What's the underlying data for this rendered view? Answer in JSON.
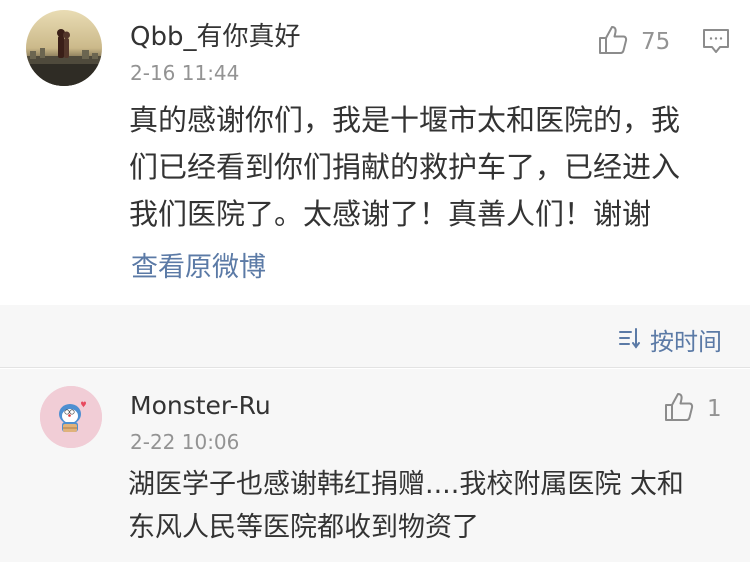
{
  "top_comment": {
    "username": "Qbb_有你真好",
    "time": "2-16 11:44",
    "text_lines": [
      "真的感谢你们，我是十堰市太和医院的，我",
      "们已经看到你们捐献的救护车了，已经进入",
      "我们医院了。太感谢了！真善人们！谢谢"
    ],
    "like_count": "75",
    "view_original": "查看原微博"
  },
  "sort": {
    "label": "按时间"
  },
  "reply": {
    "username": "Monster-Ru",
    "time": "2-22 10:06",
    "text_lines": [
      "湖医学子也感谢韩红捐赠....我校附属医院 太和",
      "东风人民等医院都收到物资了"
    ],
    "like_count": "1"
  },
  "colors": {
    "link": "#5b7aa6",
    "meta": "#939393",
    "text": "#333333",
    "band": "#f7f7f7"
  },
  "icons": {
    "like": "thumbs-up-icon",
    "comment": "comment-bubble-icon",
    "sort": "sort-lines-icon"
  }
}
